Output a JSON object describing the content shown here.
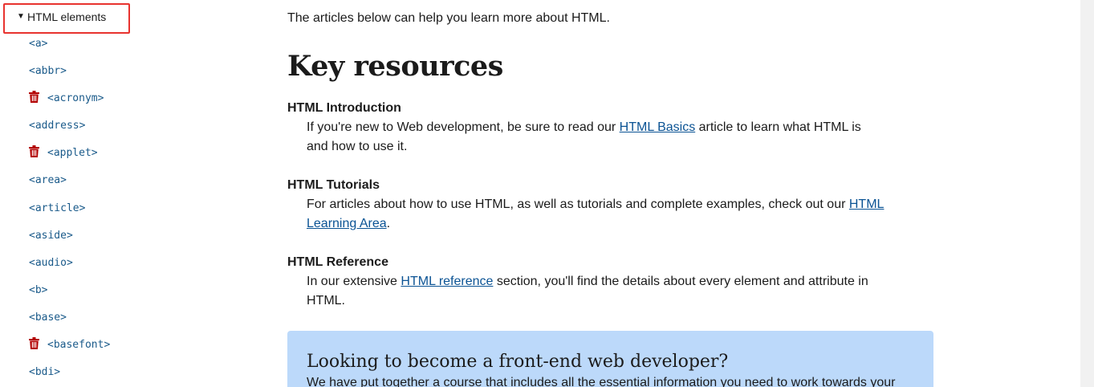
{
  "sidebar": {
    "header": {
      "caret": "▼",
      "title": "HTML elements"
    },
    "items": [
      {
        "label": "<a>",
        "deprecated": false
      },
      {
        "label": "<abbr>",
        "deprecated": false
      },
      {
        "label": "<acronym>",
        "deprecated": true
      },
      {
        "label": "<address>",
        "deprecated": false
      },
      {
        "label": "<applet>",
        "deprecated": true
      },
      {
        "label": "<area>",
        "deprecated": false
      },
      {
        "label": "<article>",
        "deprecated": false
      },
      {
        "label": "<aside>",
        "deprecated": false
      },
      {
        "label": "<audio>",
        "deprecated": false
      },
      {
        "label": "<b>",
        "deprecated": false
      },
      {
        "label": "<base>",
        "deprecated": false
      },
      {
        "label": "<basefont>",
        "deprecated": true
      },
      {
        "label": "<bdi>",
        "deprecated": false
      }
    ],
    "deprecated_icon": "trash-icon",
    "deprecated_color": "#b30000"
  },
  "main": {
    "intro": "The articles below can help you learn more about HTML.",
    "heading": "Key resources",
    "resources": [
      {
        "term": "HTML Introduction",
        "desc_before": "If you're new to Web development, be sure to read our ",
        "link": "HTML Basics",
        "desc_after": " article to learn what HTML is and how to use it."
      },
      {
        "term": "HTML Tutorials",
        "desc_before": "For articles about how to use HTML, as well as tutorials and complete examples, check out our ",
        "link": "HTML Learning Area",
        "desc_after": "."
      },
      {
        "term": "HTML Reference",
        "desc_before": "In our extensive ",
        "link": "HTML reference",
        "desc_after": " section, you'll find the details about every element and attribute in HTML."
      }
    ],
    "callout": {
      "title": "Looking to become a front-end web developer?",
      "text": "We have put together a course that includes all the essential information you need to work towards your"
    }
  },
  "colors": {
    "link": "#0b5394",
    "sidebar_link": "#1a5a8a",
    "callout_bg": "#bcd9fa",
    "highlight_border": "#e8332f"
  }
}
